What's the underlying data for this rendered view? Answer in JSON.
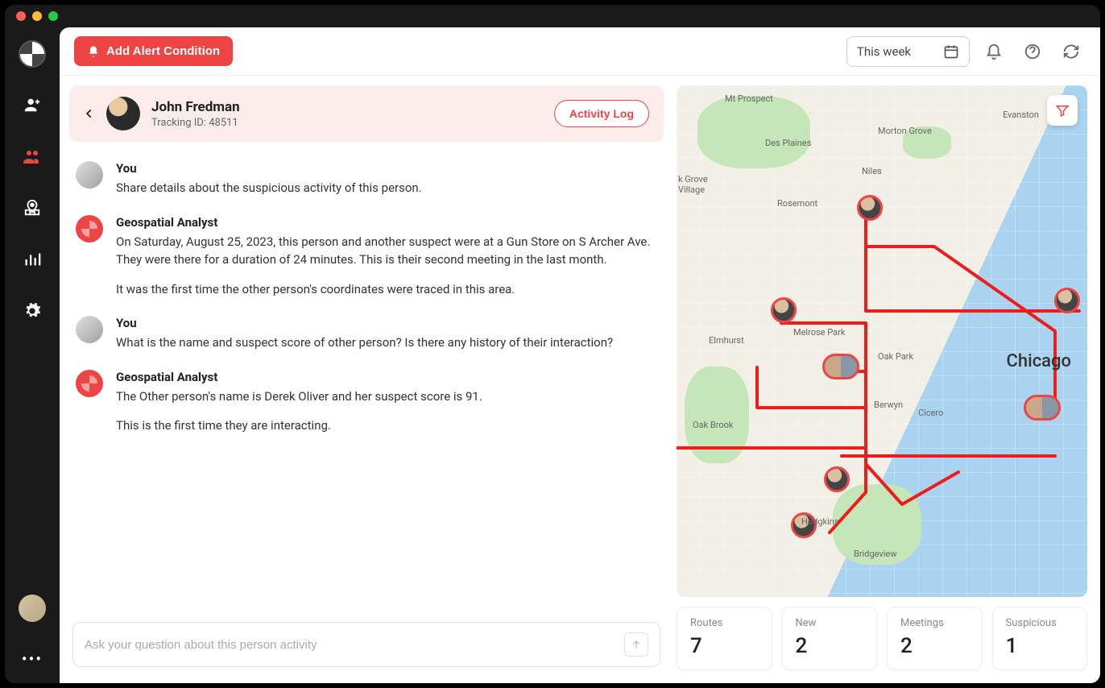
{
  "topbar": {
    "add_alert_label": "Add Alert Condition",
    "date_label": "This week"
  },
  "person": {
    "name": "John Fredman",
    "tracking_prefix": "Tracking ID: ",
    "tracking_id": "48511",
    "activity_log_label": "Activity Log"
  },
  "chat": {
    "you_label": "You",
    "analyst_label": "Geospatial Analyst",
    "msg1": "Share details about the suspicious activity of this person.",
    "msg2a": "On Saturday, August 25, 2023, this person and another suspect were at a Gun Store on S Archer Ave. They were there for a duration of 24 minutes. This is their second meeting in the last month.",
    "msg2b": "It was the first time the other person's coordinates were traced in this area.",
    "msg3": "What is the name and suspect score of other person? Is there any history of their interaction?",
    "msg4a": "The Other person's name is Derek Oliver and her suspect score is 91.",
    "msg4b": "This is the first time they are interacting.",
    "input_placeholder": "Ask your question about this person activity"
  },
  "map": {
    "labels": {
      "chicago": "Chicago",
      "mt_prospect": "Mt Prospect",
      "des_plaines": "Des Plaines",
      "evanston": "Evanston",
      "morton_grove": "Morton Grove",
      "niles": "Niles",
      "rosemont": "Rosemont",
      "elmhurst": "Elmhurst",
      "melrose_park": "Melrose Park",
      "oak_park": "Oak Park",
      "oak_brook": "Oak Brook",
      "berwyn": "Berwyn",
      "cicero": "Cicero",
      "hodgkins": "Hodgkins",
      "bridgeview": "Bridgeview",
      "k_grove": "k Grove\nVillage"
    }
  },
  "stats": [
    {
      "label": "Routes",
      "value": "7"
    },
    {
      "label": "New",
      "value": "2"
    },
    {
      "label": "Meetings",
      "value": "2"
    },
    {
      "label": "Suspicious",
      "value": "1"
    }
  ]
}
